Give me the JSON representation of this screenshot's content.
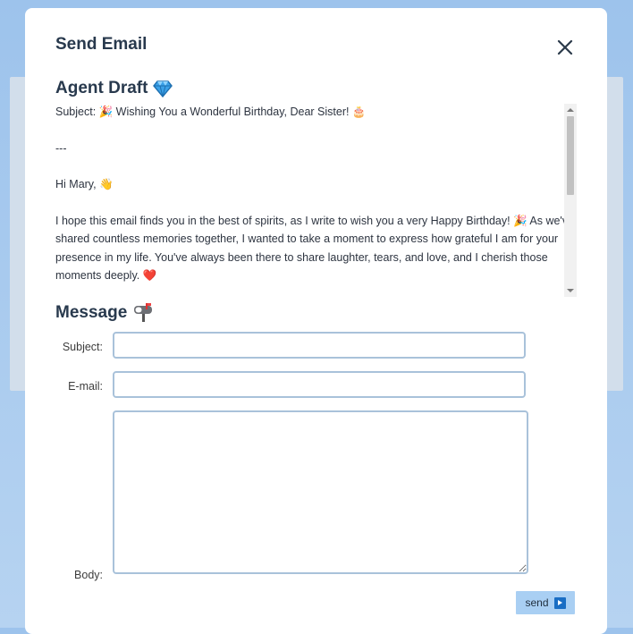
{
  "dialog": {
    "title": "Send Email",
    "close_icon": "close-icon"
  },
  "agent_draft": {
    "heading": "Agent Draft",
    "heading_icon": "gem-icon",
    "subject_line": "Subject: 🎉 Wishing You a Wonderful Birthday, Dear Sister! 🎂",
    "separator": "---",
    "greeting": "Hi Mary, 👋",
    "paragraph": "I hope this email finds you in the best of spirits, as I write to wish you a very Happy Birthday! 🎉 As we've shared countless memories together, I wanted to take a moment to express how grateful I am for your presence in my life. You've always been there to share laughter, tears, and love, and I cherish those moments deeply. ❤️"
  },
  "message": {
    "heading": "Message",
    "heading_icon": "mailbox-icon",
    "subject_label": "Subject:",
    "subject_value": "",
    "email_label": "E-mail:",
    "email_value": "",
    "body_label": "Body:",
    "body_value": "",
    "send_label": "send",
    "send_icon": "play-icon"
  },
  "colors": {
    "background": "#b6d3f1",
    "title_text": "#28394d",
    "field_border": "#a9c2da",
    "send_button": "#a9cff3",
    "send_icon": "#1a6ec4"
  }
}
